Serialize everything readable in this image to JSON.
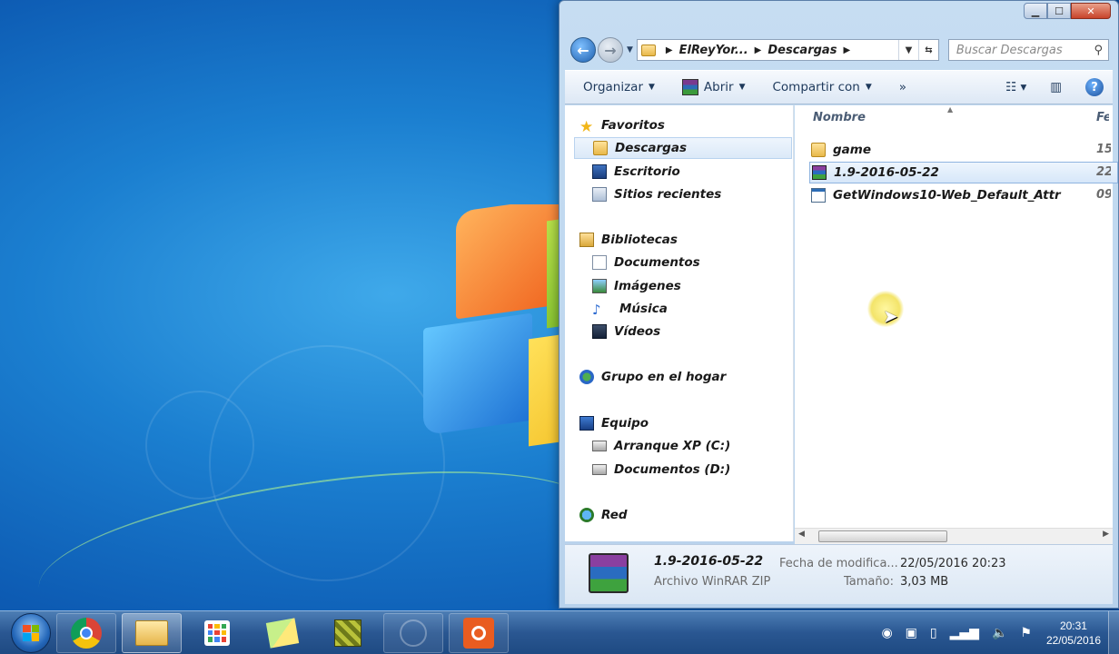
{
  "window": {
    "controls": {
      "minimize": "▁",
      "maximize": "☐",
      "close": "✕"
    },
    "nav": {
      "back_icon": "arrow-left-icon",
      "forward_icon": "arrow-right-icon",
      "dropdown": "▼"
    },
    "address": {
      "segments": [
        "ElReyYor...",
        "Descargas"
      ],
      "separator": "▶"
    },
    "search": {
      "placeholder": "Buscar Descargas"
    },
    "toolbar": {
      "organize": "Organizar",
      "open": "Abrir",
      "share": "Compartir con",
      "more": "»",
      "view_icon": "view-options-icon",
      "help_label": "?"
    },
    "nav_pane": {
      "favorites_header": "Favoritos",
      "favorites": [
        "Descargas",
        "Escritorio",
        "Sitios recientes"
      ],
      "libraries_header": "Bibliotecas",
      "libraries": [
        "Documentos",
        "Imágenes",
        "Música",
        "Vídeos"
      ],
      "homegroup": "Grupo en el hogar",
      "computer_header": "Equipo",
      "drives": [
        "Arranque XP (C:)",
        "Documentos (D:)"
      ],
      "network": "Red"
    },
    "file_list": {
      "col_name": "Nombre",
      "col_date": "Fe",
      "files": [
        {
          "name": "game",
          "type": "folder",
          "date": "15"
        },
        {
          "name": "1.9-2016-05-22",
          "type": "rar",
          "date": "22",
          "selected": true
        },
        {
          "name": "GetWindows10-Web_Default_Attr",
          "type": "exe",
          "date": "09"
        }
      ]
    },
    "details": {
      "name": "1.9-2016-05-22",
      "type": "Archivo WinRAR ZIP",
      "modified_label": "Fecha de modifica...",
      "modified_value": "22/05/2016 20:23",
      "size_label": "Tamaño:",
      "size_value": "3,03 MB"
    }
  },
  "taskbar": {
    "apps": [
      "chrome-icon",
      "explorer-icon",
      "apps-launcher-icon",
      "sticky-notes-icon",
      "minecraft-icon",
      "app-icon",
      "orange-app-icon"
    ],
    "tray_icons": [
      "screen-capture-icon",
      "display-icon",
      "battery-icon",
      "signal-icon",
      "volume-icon",
      "action-center-icon"
    ],
    "time": "20:31",
    "date": "22/05/2016"
  },
  "colors": {
    "desktop": "#1b7fd0",
    "window_frame": "#c6ddf2",
    "selection": "#d6e7f9",
    "taskbar": "#2a5792"
  }
}
